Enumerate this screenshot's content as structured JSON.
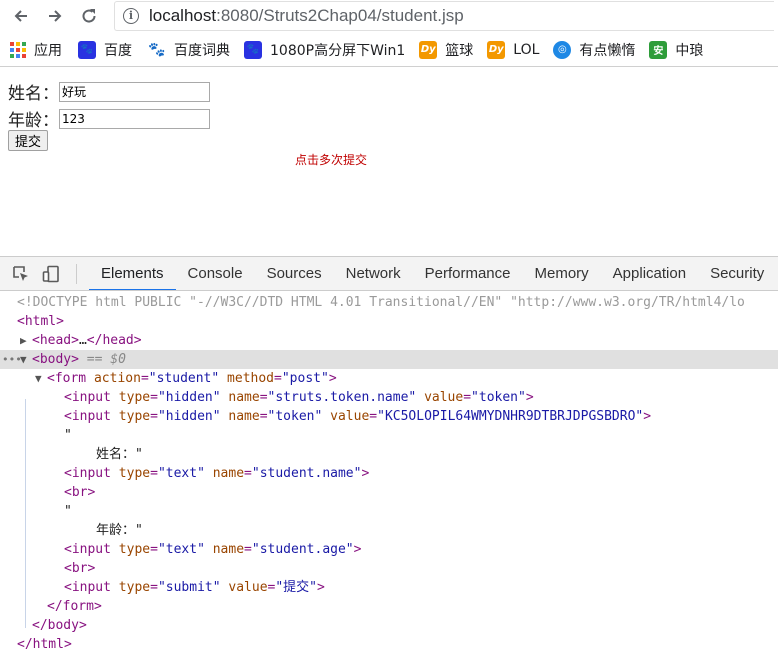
{
  "browser": {
    "url_host": "localhost",
    "url_path": ":8080/Struts2Chap04/student.jsp",
    "bookmarks": [
      {
        "label": "应用",
        "icon": "apps-grid-icon"
      },
      {
        "label": "百度",
        "icon": "baidu-paw-icon",
        "color": "#2932e1"
      },
      {
        "label": "百度词典",
        "icon": "baidu-dict-icon",
        "color": "#2932e1"
      },
      {
        "label": "1080P高分屏下Win1",
        "icon": "baidu-paw-icon",
        "color": "#2932e1"
      },
      {
        "label": "篮球",
        "icon": "dy-icon",
        "color": "#f39800"
      },
      {
        "label": "LOL",
        "icon": "dy-icon",
        "color": "#f39800"
      },
      {
        "label": "有点懒惰",
        "icon": "circle-logo-icon",
        "color": "#1e88e5"
      },
      {
        "label": "中琅",
        "icon": "an-icon",
        "color": "#2e9d3a"
      }
    ]
  },
  "page": {
    "name_label": "姓名：",
    "name_value": "好玩",
    "age_label": "年龄：",
    "age_value": "123",
    "submit_label": "提交",
    "notice": "点击多次提交"
  },
  "devtools": {
    "tabs": [
      "Elements",
      "Console",
      "Sources",
      "Network",
      "Performance",
      "Memory",
      "Application",
      "Security"
    ],
    "active_tab": "Elements",
    "doctype": "<!DOCTYPE html PUBLIC \"-//W3C//DTD HTML 4.01 Transitional//EN\" \"http://www.w3.org/TR/html4/lo",
    "selected_suffix": " == $0",
    "token_value": "KC5OLOPIL64WMYDNHR9DTBRJDPGSBDRO",
    "text_name": "姓名：\"",
    "text_age": "年龄：\""
  }
}
